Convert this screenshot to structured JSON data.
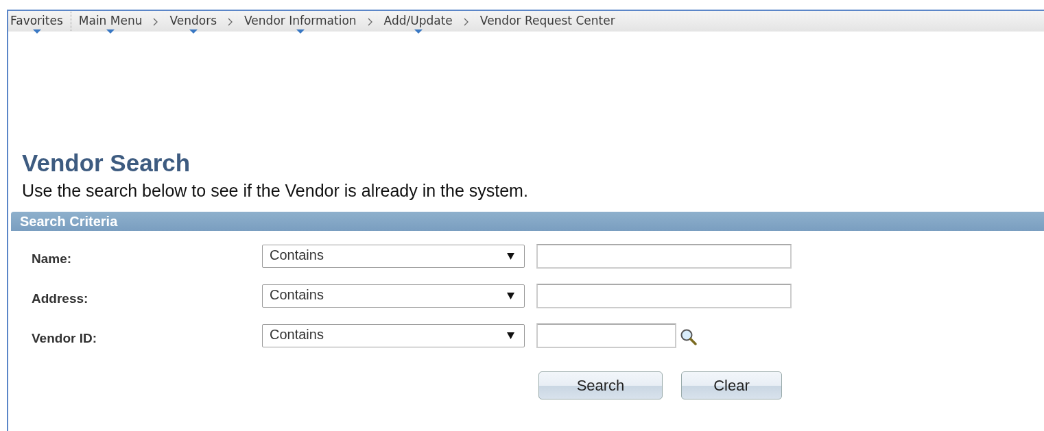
{
  "breadcrumbs": [
    {
      "label": "Favorites",
      "has_menu": true,
      "kind": "favorites"
    },
    {
      "label": "Main Menu",
      "has_menu": true,
      "kind": "crumb"
    },
    {
      "label": "Vendors",
      "has_menu": true,
      "kind": "crumb"
    },
    {
      "label": "Vendor Information",
      "has_menu": true,
      "kind": "crumb"
    },
    {
      "label": "Add/Update",
      "has_menu": true,
      "kind": "crumb"
    },
    {
      "label": "Vendor Request Center",
      "has_menu": false,
      "kind": "crumb"
    }
  ],
  "page": {
    "title": "Vendor Search",
    "description": "Use the search below to see if the Vendor is already in the system."
  },
  "search_criteria": {
    "title": "Search Criteria",
    "fields": [
      {
        "label": "Name:",
        "operator": "Contains",
        "lookup": false
      },
      {
        "label": "Address:",
        "operator": "Contains",
        "lookup": false
      },
      {
        "label": "Vendor ID:",
        "operator": "Contains",
        "lookup": true
      }
    ]
  },
  "buttons": [
    "Search",
    "Clear"
  ]
}
